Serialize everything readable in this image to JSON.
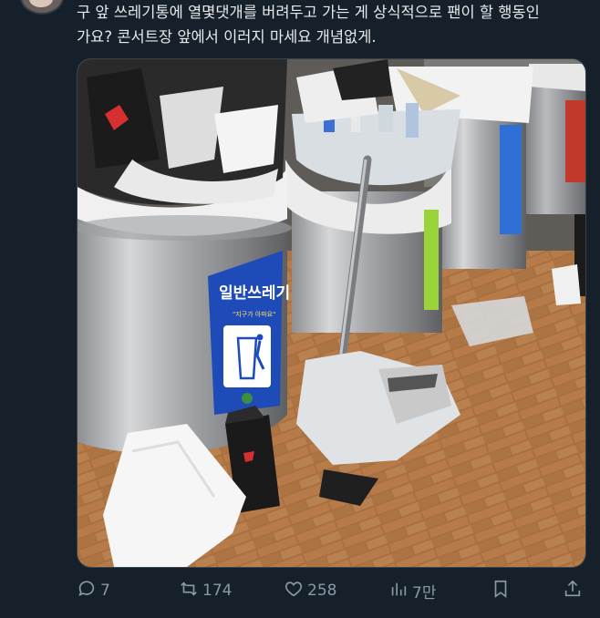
{
  "tweet": {
    "line1": "구 앞 쓰레기통에 열몇댓개를 버려두고 가는 게 상식적으로 팬이 할 행동인",
    "line2": "가요? 콘서트장 앞에서 이러지 마세요 개념없게."
  },
  "bin_sign": {
    "title": "일반쓰레기",
    "subtitle": "\"지구가 아파요\""
  },
  "actions": {
    "replies": "7",
    "retweets": "174",
    "likes": "258",
    "views": "7만"
  }
}
